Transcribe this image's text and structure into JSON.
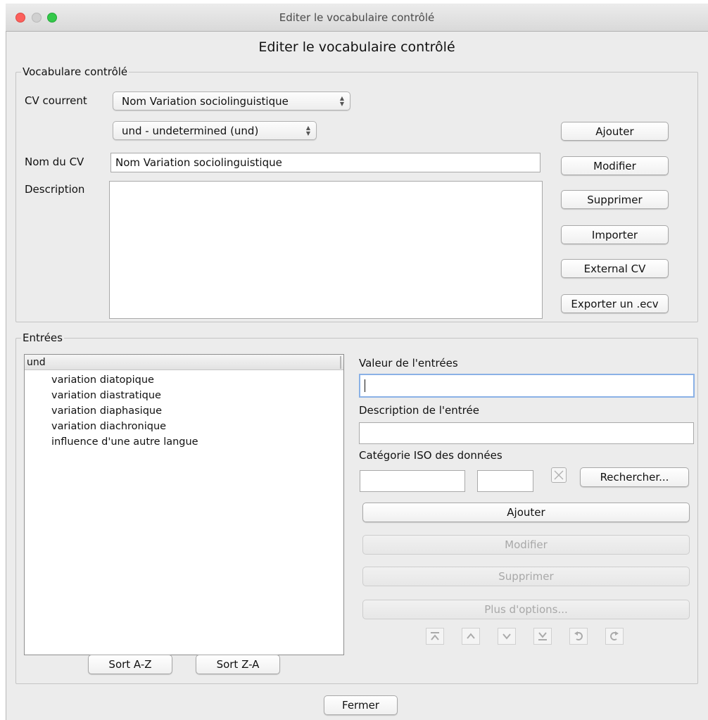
{
  "window": {
    "title": "Editer le vocabulaire contrôlé",
    "dialog_title": "Editer le vocabulaire contrôlé"
  },
  "cv_group": {
    "legend": "Vocabulare contrôlé",
    "current_label": "CV courrent",
    "current_value": "Nom Variation sociolinguistique",
    "language_value": "und - undetermined (und)",
    "name_label": "Nom du CV",
    "name_value": "Nom Variation sociolinguistique",
    "description_label": "Description",
    "description_value": "",
    "buttons": {
      "add": "Ajouter",
      "modify": "Modifier",
      "delete": "Supprimer",
      "import": "Importer",
      "external": "External CV",
      "export": "Exporter un .ecv"
    }
  },
  "entries_group": {
    "legend": "Entrées",
    "list_header": "und",
    "items": [
      "variation diatopique",
      "variation diastratique",
      "variation diaphasique",
      "variation diachronique",
      "influence d'une autre langue"
    ],
    "value_label": "Valeur de l'entrées",
    "value_input": "",
    "desc_label": "Description de l'entrée",
    "desc_input": "",
    "iso_label": "Catégorie ISO des données",
    "search_button": "Rechercher...",
    "add_button": "Ajouter",
    "modify_button": "Modifier",
    "delete_button": "Supprimer",
    "more_button": "Plus d'options...",
    "sort_az": "Sort A-Z",
    "sort_za": "Sort Z-A"
  },
  "close_button": "Fermer",
  "colors": {
    "close": "#fc605c",
    "minimize": "#d0d0d0",
    "zoom": "#34c84a",
    "focus_ring": "#8ab1e6"
  }
}
